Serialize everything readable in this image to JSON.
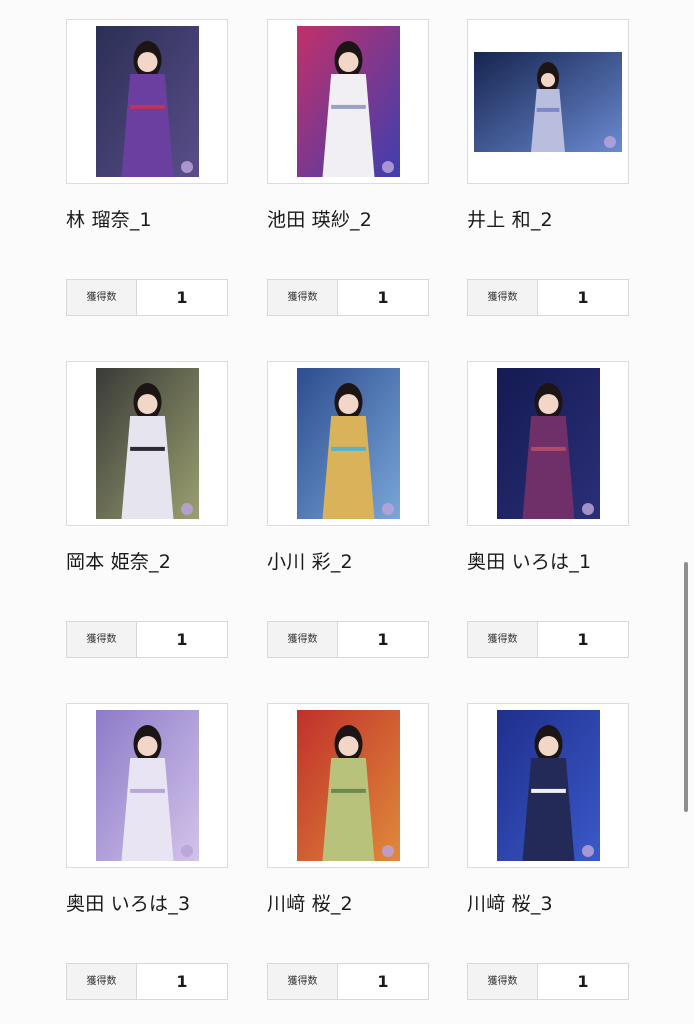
{
  "count_label": "獲得数",
  "photos": [
    {
      "name": "林 瑠奈_1",
      "count": "1",
      "orientation": "portrait",
      "bg": [
        "#2b2f55",
        "#5a4e8a"
      ],
      "dress": "#6b3fa0",
      "accent": "#c0345a"
    },
    {
      "name": "池田 瑛紗_2",
      "count": "1",
      "orientation": "portrait",
      "bg": [
        "#c2306a",
        "#3d3fb0"
      ],
      "dress": "#f1eff4",
      "accent": "#9aa0c8"
    },
    {
      "name": "井上 和_2",
      "count": "1",
      "orientation": "landscape",
      "bg": [
        "#16244f",
        "#6a8ad1"
      ],
      "dress": "#b9bdde",
      "accent": "#7c86c9"
    },
    {
      "name": "岡本 姫奈_2",
      "count": "1",
      "orientation": "portrait",
      "bg": [
        "#3a3a38",
        "#9aa070"
      ],
      "dress": "#e6e4ee",
      "accent": "#2a2a33"
    },
    {
      "name": "小川 彩_2",
      "count": "1",
      "orientation": "portrait",
      "bg": [
        "#2c4d8f",
        "#7aa6d8"
      ],
      "dress": "#d9b25a",
      "accent": "#56b3c9"
    },
    {
      "name": "奥田 いろは_1",
      "count": "1",
      "orientation": "portrait",
      "bg": [
        "#141a52",
        "#2b2f78"
      ],
      "dress": "#6f2f68",
      "accent": "#b04a6a"
    },
    {
      "name": "奥田 いろは_3",
      "count": "1",
      "orientation": "portrait",
      "bg": [
        "#8d7bc8",
        "#d2c3ea"
      ],
      "dress": "#e8e4f4",
      "accent": "#b7a6d8"
    },
    {
      "name": "川﨑 桜_2",
      "count": "1",
      "orientation": "portrait",
      "bg": [
        "#c0302b",
        "#e08a3a"
      ],
      "dress": "#b9c27a",
      "accent": "#6b8a4f"
    },
    {
      "name": "川﨑 桜_3",
      "count": "1",
      "orientation": "portrait",
      "bg": [
        "#1f2f8c",
        "#3a59c9"
      ],
      "dress": "#232a58",
      "accent": "#f0f0f6"
    }
  ]
}
